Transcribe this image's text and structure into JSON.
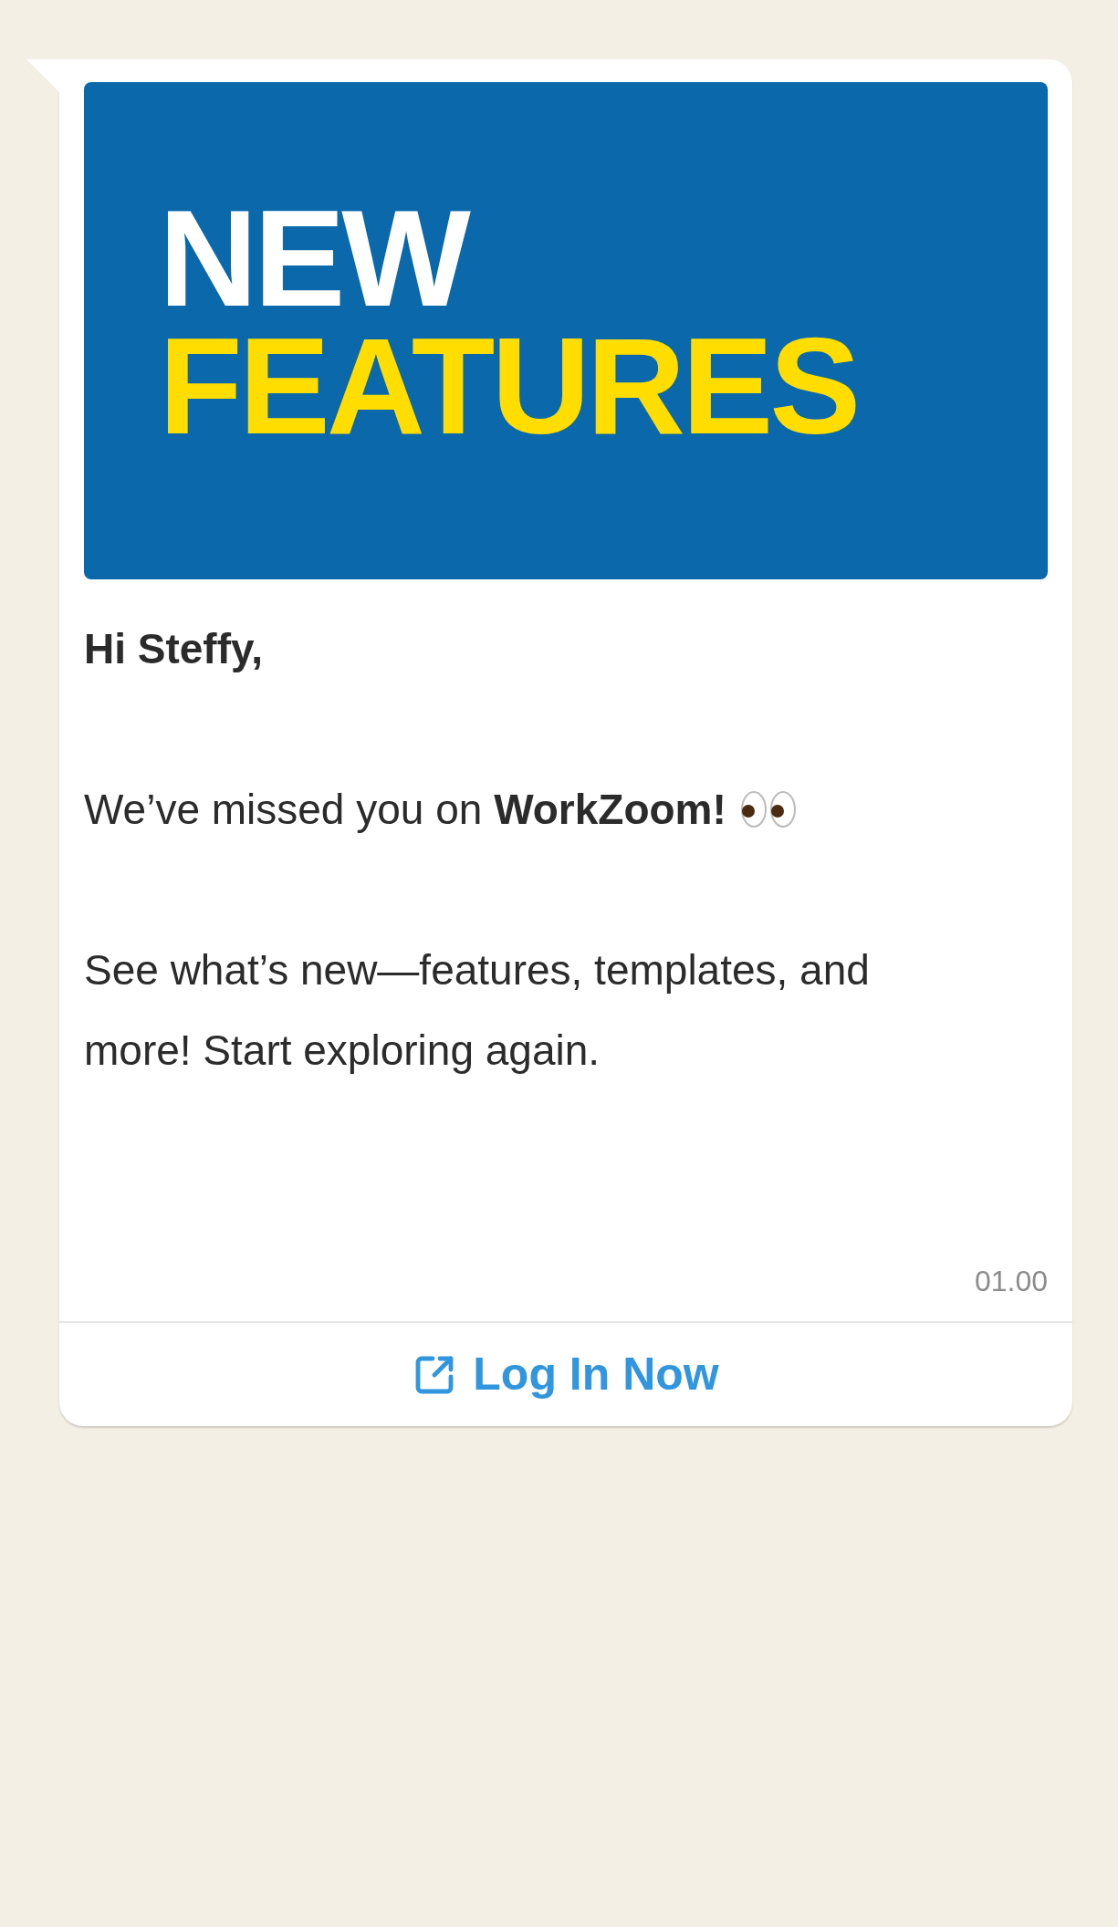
{
  "banner": {
    "line_1": "NEW",
    "line_2": "FEATURES"
  },
  "message": {
    "greeting": "Hi Steffy,",
    "paragraphs": [
      "We’ve missed you on **WorkZoom!**",
      "See what’s new—features, templates, and more! Start exploring again."
    ],
    "time": "01.00"
  },
  "action": {
    "label": "Log In Now"
  }
}
